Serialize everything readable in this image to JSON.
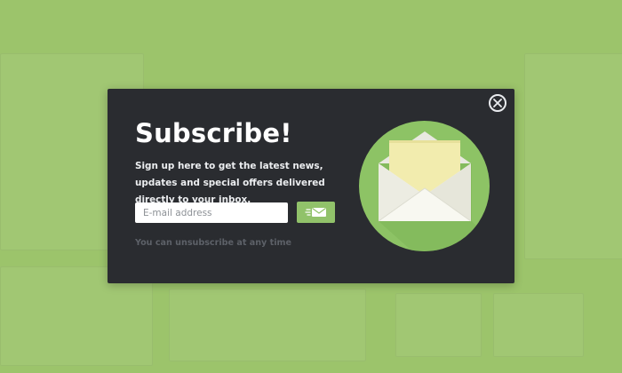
{
  "popup": {
    "title": "Subscribe!",
    "description": "Sign up here to get the latest news, updates and special offers delivered directly to your inbox.",
    "email_placeholder": "E-mail address",
    "email_value": "",
    "unsubscribe_note": "You can unsubscribe at any time",
    "send_icon": "send-mail-icon",
    "close_icon": "close-icon",
    "illustration_icon": "open-envelope-icon"
  },
  "colors": {
    "backdrop": "#9cc46b",
    "modal": "#2a2c30",
    "accent": "#91c26a"
  }
}
